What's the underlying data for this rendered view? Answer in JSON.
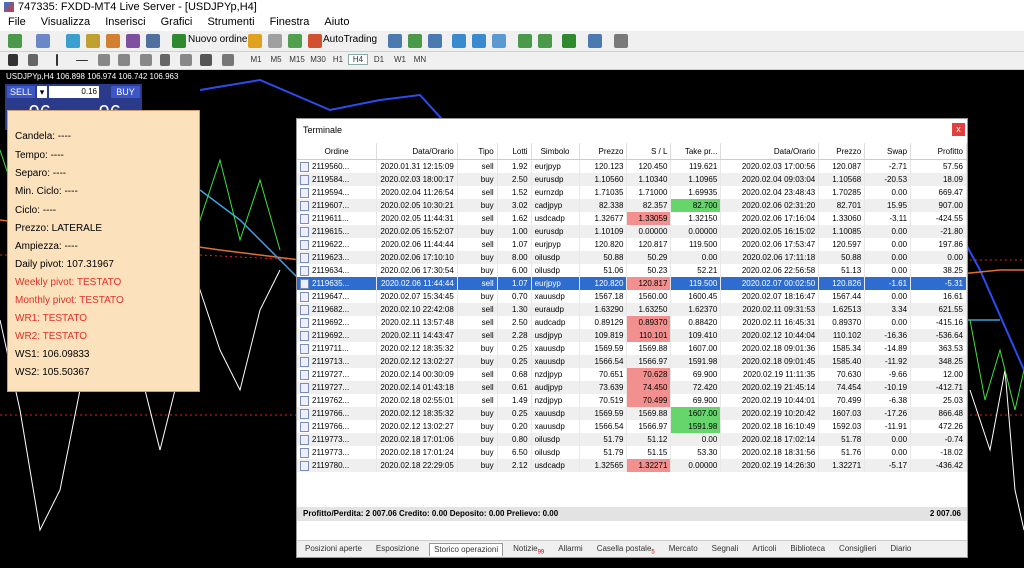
{
  "window": {
    "title": "747335: FXDD-MT4 Live Server - [USDJPYp,H4]"
  },
  "menu": [
    "File",
    "Visualizza",
    "Inserisci",
    "Grafici",
    "Strumenti",
    "Finestra",
    "Aiuto"
  ],
  "toolbar": {
    "new_order": "Nuovo ordine",
    "autotrading": "AutoTrading"
  },
  "timeframes": [
    "M1",
    "M5",
    "M15",
    "M30",
    "H1",
    "H4",
    "D1",
    "W1",
    "MN"
  ],
  "active_timeframe": "H4",
  "chart": {
    "symbol_line": "USDJPYp,H4  106.898 106.974 106.742 106.963",
    "trade_panel": {
      "sell": "SELL",
      "buy": "BUY",
      "lot": "0.16",
      "sell_small": "106",
      "sell_big": "96",
      "sell_sup": "3",
      "buy_small": "106",
      "buy_big": "96",
      "buy_sup": "9"
    }
  },
  "info_panel": {
    "candela": "Candela: ----",
    "tempo": "Tempo: ----",
    "separo": "Separo: ----",
    "min_ciclo": "Min. Ciclo: ----",
    "ciclo": "Ciclo: ----",
    "prezzo": "Prezzo: LATERALE",
    "ampiezza": "Ampiezza: ----",
    "daily_pivot": "Daily pivot: 107.31967",
    "weekly_pivot": "Weekly pivot: TESTATO",
    "monthly_pivot": "Monthly pivot: TESTATO",
    "wr1": "WR1: TESTATO",
    "wr2": "WR2: TESTATO",
    "ws1": "WS1: 106.09833",
    "ws2": "WS2: 105.50367"
  },
  "terminal": {
    "title": "Terminale",
    "close": "x",
    "columns": [
      "Ordine",
      "Data/Orario",
      "Tipo",
      "Lotti",
      "Simbolo",
      "Prezzo",
      "S / L",
      "Take pr...",
      "Data/Orario",
      "Prezzo",
      "Swap",
      "Profitto"
    ],
    "rows": [
      [
        "2119560...",
        "2020.01.31 12:15:09",
        "sell",
        "1.92",
        "eurjpyp",
        "120.123",
        "120.450",
        "119.621",
        "2020.02.03 17:00:56",
        "120.087",
        "-2.71",
        "57.56"
      ],
      [
        "2119584...",
        "2020.02.03 18:00:17",
        "buy",
        "2.50",
        "eurusdp",
        "1.10560",
        "1.10340",
        "1.10965",
        "2020.02.04 09:03:04",
        "1.10568",
        "-20.53",
        "18.09"
      ],
      [
        "2119594...",
        "2020.02.04 11:26:54",
        "sell",
        "1.52",
        "eurnzdp",
        "1.71035",
        "1.71000",
        "1.69935",
        "2020.02.04 23:48:43",
        "1.70285",
        "0.00",
        "669.47"
      ],
      [
        "2119607...",
        "2020.02.05 10:30:21",
        "buy",
        "3.02",
        "cadjpyp",
        "82.338",
        "82.357",
        "82.700",
        "2020.02.06 02:31:20",
        "82.701",
        "15.95",
        "907.00"
      ],
      [
        "2119611...",
        "2020.02.05 11:44:31",
        "sell",
        "1.62",
        "usdcadp",
        "1.32677",
        "1.33059",
        "1.32150",
        "2020.02.06 17:16:04",
        "1.33060",
        "-3.11",
        "-424.55"
      ],
      [
        "2119615...",
        "2020.02.05 15:52:07",
        "buy",
        "1.00",
        "eurusdp",
        "1.10109",
        "0.00000",
        "0.00000",
        "2020.02.05 16:15:02",
        "1.10085",
        "0.00",
        "-21.80"
      ],
      [
        "2119622...",
        "2020.02.06 11:44:44",
        "sell",
        "1.07",
        "eurjpyp",
        "120.820",
        "120.817",
        "119.500",
        "2020.02.06 17:53:47",
        "120.597",
        "0.00",
        "197.86"
      ],
      [
        "2119623...",
        "2020.02.06 17:10:10",
        "buy",
        "8.00",
        "oilusdp",
        "50.88",
        "50.29",
        "0.00",
        "2020.02.06 17:11:18",
        "50.88",
        "0.00",
        "0.00"
      ],
      [
        "2119634...",
        "2020.02.06 17:30:54",
        "buy",
        "6.00",
        "oilusdp",
        "51.06",
        "50.23",
        "52.21",
        "2020.02.06 22:56:58",
        "51.13",
        "0.00",
        "38.25"
      ],
      [
        "2119635...",
        "2020.02.06 11:44:44",
        "sell",
        "1.07",
        "eurjpyp",
        "120.820",
        "120.817",
        "119.500",
        "2020.02.07 00:02:50",
        "120.826",
        "-1.61",
        "-5.31"
      ],
      [
        "2119647...",
        "2020.02.07 15:34:45",
        "buy",
        "0.70",
        "xauusdp",
        "1567.18",
        "1560.00",
        "1600.45",
        "2020.02.07 18:16:47",
        "1567.44",
        "0.00",
        "16.61"
      ],
      [
        "2119682...",
        "2020.02.10 22:42:08",
        "sell",
        "1.30",
        "euraudp",
        "1.63290",
        "1.63250",
        "1.62370",
        "2020.02.11 09:31:53",
        "1.62513",
        "3.34",
        "621.55"
      ],
      [
        "2119692...",
        "2020.02.11 13:57:48",
        "sell",
        "2.50",
        "audcadp",
        "0.89129",
        "0.89370",
        "0.88420",
        "2020.02.11 16:45:31",
        "0.89370",
        "0.00",
        "-415.16"
      ],
      [
        "2119692...",
        "2020.02.11 14:43:47",
        "sell",
        "2.28",
        "usdjpyp",
        "109.819",
        "110.101",
        "109.410",
        "2020.02.12 10:44:04",
        "110.102",
        "-16.36",
        "-536.64"
      ],
      [
        "2119711...",
        "2020.02.12 18:35:32",
        "buy",
        "0.25",
        "xauusdp",
        "1569.59",
        "1569.88",
        "1607.00",
        "2020.02.18 09:01:36",
        "1585.34",
        "-14.89",
        "363.53"
      ],
      [
        "2119713...",
        "2020.02.12 13:02:27",
        "buy",
        "0.25",
        "xauusdp",
        "1566.54",
        "1566.97",
        "1591.98",
        "2020.02.18 09:01:45",
        "1585.40",
        "-11.92",
        "348.25"
      ],
      [
        "2119727...",
        "2020.02.14 00:30:09",
        "sell",
        "0.68",
        "nzdjpyp",
        "70.651",
        "70.628",
        "69.900",
        "2020.02.19 11:11:35",
        "70.630",
        "-9.66",
        "12.00"
      ],
      [
        "2119727...",
        "2020.02.14 01:43:18",
        "sell",
        "0.61",
        "audjpyp",
        "73.639",
        "74.450",
        "72.420",
        "2020.02.19 21:45:14",
        "74.454",
        "-10.19",
        "-412.71"
      ],
      [
        "2119762...",
        "2020.02.18 02:55:01",
        "sell",
        "1.49",
        "nzdjpyp",
        "70.519",
        "70.499",
        "69.900",
        "2020.02.19 10:44:01",
        "70.499",
        "-6.38",
        "25.03"
      ],
      [
        "2119766...",
        "2020.02.12 18:35:32",
        "buy",
        "0.25",
        "xauusdp",
        "1569.59",
        "1569.88",
        "1607.00",
        "2020.02.19 10:20:42",
        "1607.03",
        "-17.26",
        "866.48"
      ],
      [
        "2119766...",
        "2020.02.12 13:02:27",
        "buy",
        "0.20",
        "xauusdp",
        "1566.54",
        "1566.97",
        "1591.98",
        "2020.02.18 16:10:49",
        "1592.03",
        "-11.91",
        "472.26"
      ],
      [
        "2119773...",
        "2020.02.18 17:01:06",
        "buy",
        "0.80",
        "oilusdp",
        "51.79",
        "51.12",
        "0.00",
        "2020.02.18 17:02:14",
        "51.78",
        "0.00",
        "-0.74"
      ],
      [
        "2119773...",
        "2020.02.18 17:01:24",
        "buy",
        "6.50",
        "oilusdp",
        "51.79",
        "51.15",
        "53.30",
        "2020.02.18 18:31:56",
        "51.76",
        "0.00",
        "-18.02"
      ],
      [
        "2119780...",
        "2020.02.18 22:29:05",
        "buy",
        "2.12",
        "usdcadp",
        "1.32565",
        "1.32271",
        "0.00000",
        "2020.02.19 14:26:30",
        "1.32271",
        "-5.17",
        "-436.42"
      ]
    ],
    "highlight": {
      "red": [
        [
          4,
          6
        ],
        [
          12,
          6
        ],
        [
          13,
          6
        ],
        [
          16,
          6
        ],
        [
          17,
          6
        ],
        [
          18,
          6
        ],
        [
          23,
          6
        ],
        [
          9,
          6
        ]
      ],
      "green": [
        [
          3,
          7
        ],
        [
          19,
          7
        ],
        [
          20,
          7
        ]
      ]
    },
    "selected_row": 9,
    "summary": "Profitto/Perdita: 2 007.06  Credito: 0.00  Deposito: 0.00  Prelievo: 0.00",
    "summary_total": "2 007.06",
    "tabs": [
      {
        "label": "Posizioni aperte"
      },
      {
        "label": "Esposizione"
      },
      {
        "label": "Storico operazioni",
        "active": true
      },
      {
        "label": "Notizie",
        "badge": "99"
      },
      {
        "label": "Allarmi"
      },
      {
        "label": "Casella postale",
        "badge": "5"
      },
      {
        "label": "Mercato"
      },
      {
        "label": "Segnali"
      },
      {
        "label": "Articoli"
      },
      {
        "label": "Biblioteca"
      },
      {
        "label": "Consiglieri"
      },
      {
        "label": "Diario"
      }
    ]
  },
  "colors": {
    "chart_bg": "#000000",
    "info_bg": "#fbe1bc",
    "selection": "#2f6cd0",
    "sl_hit": "#f29090",
    "tp_hit": "#66d56b"
  }
}
